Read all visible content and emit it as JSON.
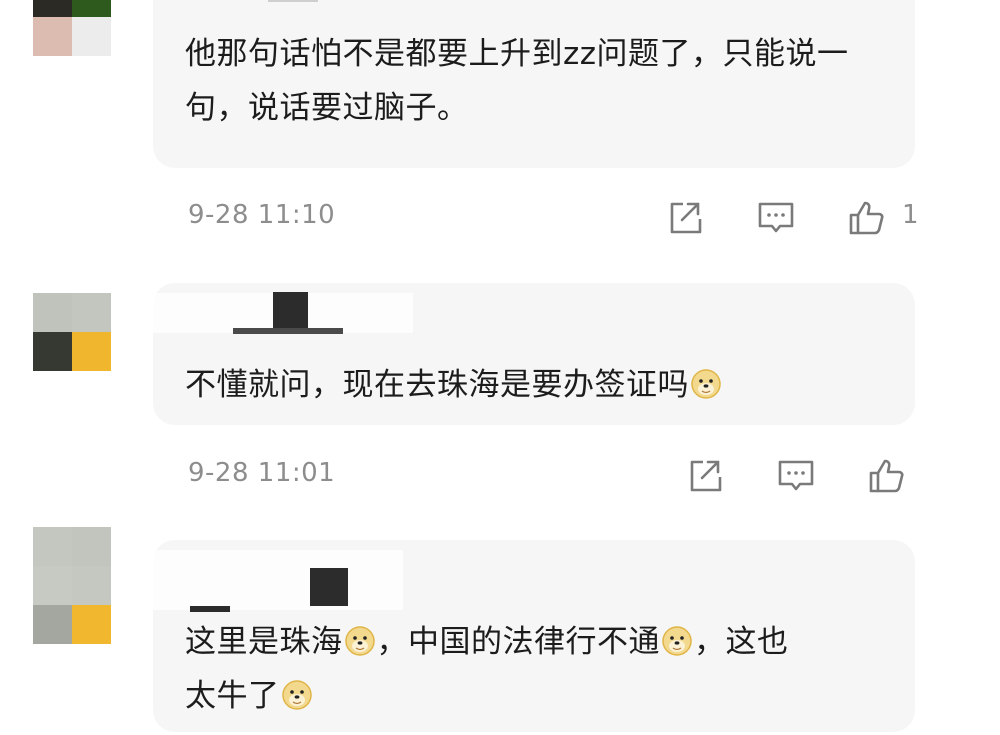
{
  "comments": [
    {
      "text": "他那句话怕不是都要上升到zz问题了，只能说一句，说话要过脑子。",
      "time": "9-28 11:10",
      "likes": "1",
      "avatar_colors": [
        "#2b2a24",
        "#2e5a1e",
        "#dcbcb0",
        "#ececec"
      ]
    },
    {
      "text": "不懂就问，现在去珠海是要办签证吗",
      "time": "9-28 11:01",
      "likes": "",
      "avatar_colors": [
        "#bfc3bc",
        "#c2c6bf",
        "#363832",
        "#f0b62e"
      ]
    },
    {
      "text_parts": [
        "这里是珠海",
        "，中国的法律行不通",
        "，这也",
        "太牛了"
      ],
      "avatar_colors": [
        "#c3c7c0",
        "#c1c5be",
        "#c6cac3",
        "#c4c8c1",
        "#a4a6a0",
        "#f1b72f"
      ]
    }
  ],
  "icons": {
    "share": "share-icon",
    "reply": "comment-icon",
    "like": "thumbs-up-icon",
    "emoji": "doge-emoji-icon"
  },
  "colors": {
    "bubble": "#f6f6f6",
    "meta_text": "#8d8d8d",
    "icon_stroke": "#7a7a7a"
  }
}
